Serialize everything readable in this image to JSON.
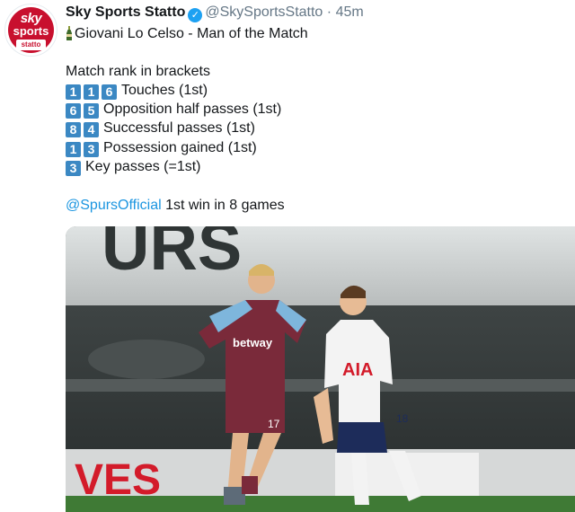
{
  "tweet": {
    "display_name": "Sky Sports Statto",
    "handle": "@SkySportsStatto",
    "separator": "·",
    "time": "45m",
    "avatar": {
      "line1": "sky",
      "line2": "sports",
      "line3": "statto"
    },
    "headline": "Giovani Lo Celso - Man of the Match",
    "intro": "Match rank in brackets",
    "stats": [
      {
        "digits": [
          "1",
          "1",
          "6"
        ],
        "label": "Touches (1st)"
      },
      {
        "digits": [
          "6",
          "5"
        ],
        "label": "Opposition half passes (1st)"
      },
      {
        "digits": [
          "8",
          "4"
        ],
        "label": "Successful passes (1st)"
      },
      {
        "digits": [
          "1",
          "3"
        ],
        "label": "Possession gained (1st)"
      },
      {
        "digits": [
          "3"
        ],
        "label": "Key passes (=1st)"
      }
    ],
    "mention": "@SpursOfficial",
    "footer_text": " 1st win in 8 games",
    "photo": {
      "shirt_sponsor_left": "betway",
      "shirt_sponsor_right": "AIA",
      "number_left": "17",
      "number_right": "18",
      "stadium_letters": "URS"
    }
  }
}
